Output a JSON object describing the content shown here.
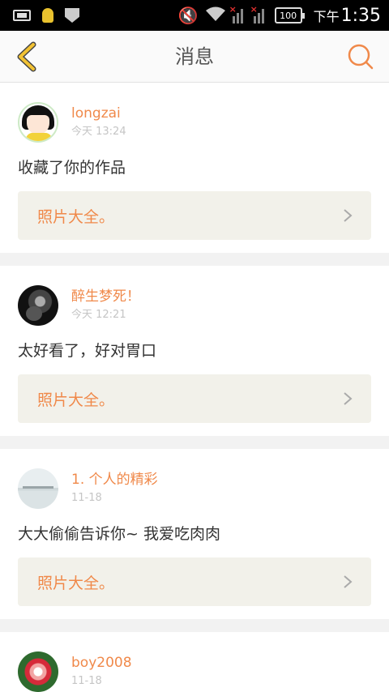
{
  "status_bar": {
    "battery": "100",
    "ampm": "下午",
    "time": "1:35"
  },
  "header": {
    "title": "消息"
  },
  "messages": [
    {
      "username": "longzai",
      "time": "今天 13:24",
      "text": "收藏了你的作品",
      "reference": "照片大全。",
      "avatar": "maruko-avatar"
    },
    {
      "username": "醉生梦死！",
      "time": "今天 12:21",
      "text": "太好看了，好对胃口",
      "reference": "照片大全。",
      "avatar": "dark-portrait-avatar"
    },
    {
      "username": "1. 个人的精彩",
      "time": "11-18",
      "text": "大大偷偷告诉你~ 我爱吃肉肉",
      "reference": "照片大全。",
      "avatar": "seascape-avatar"
    },
    {
      "username": "boy2008",
      "time": "11-18",
      "text": "",
      "reference": "",
      "avatar": "rose-avatar"
    }
  ],
  "colors": {
    "accent": "#f0894a",
    "back_arrow": "#e8a020",
    "reference_bg": "#f2f1ea",
    "page_bg": "#f2f2f2"
  }
}
